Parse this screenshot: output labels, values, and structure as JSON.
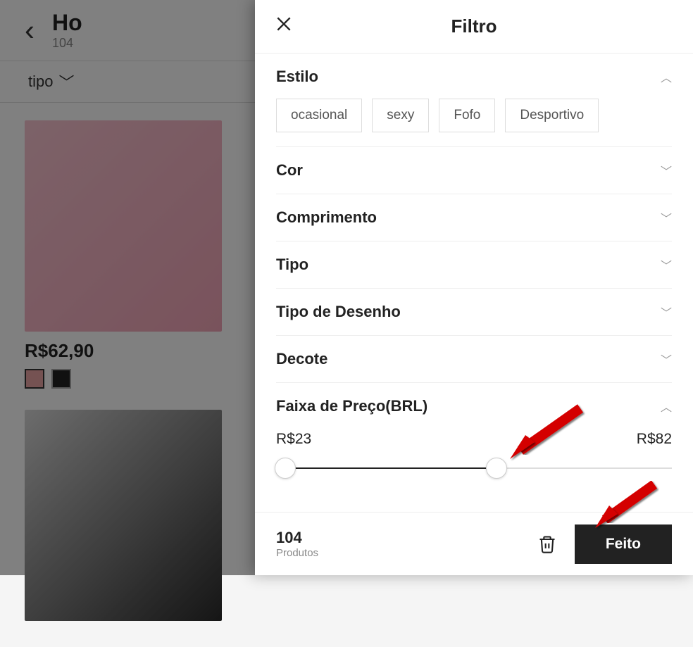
{
  "background": {
    "title_prefix": "Ho",
    "subtitle_prefix": "104",
    "filter_chip": "tipo",
    "price1": "R$62,90"
  },
  "panel": {
    "title": "Filtro",
    "close_symbol": "✕",
    "chevron_up": "︿",
    "chevron_down": "﹀"
  },
  "sections": {
    "estilo": {
      "title": "Estilo",
      "expanded": true,
      "options": [
        "ocasional",
        "sexy",
        "Fofo",
        "Desportivo"
      ]
    },
    "cor": {
      "title": "Cor",
      "expanded": false
    },
    "comprimento": {
      "title": "Comprimento",
      "expanded": false
    },
    "tipo": {
      "title": "Tipo",
      "expanded": false
    },
    "tipo_desenho": {
      "title": "Tipo de Desenho",
      "expanded": false
    },
    "decote": {
      "title": "Decote",
      "expanded": false
    },
    "preco": {
      "title": "Faixa de Preço(BRL)",
      "expanded": true,
      "min_label": "R$23",
      "max_label": "R$82",
      "min_value": 23,
      "max_value": 82,
      "current_min": 23,
      "current_max": 55
    }
  },
  "footer": {
    "count": "104",
    "count_label": "Produtos",
    "done_label": "Feito"
  }
}
